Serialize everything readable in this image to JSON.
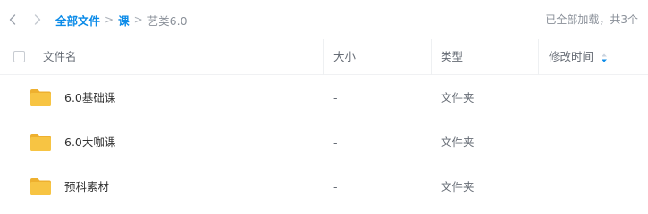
{
  "nav": {
    "back_icon": "chevron-left-icon",
    "forward_icon": "chevron-right-icon"
  },
  "breadcrumb": {
    "root": "全部文件",
    "separator": ">",
    "level1": "课",
    "current": "艺类6.0"
  },
  "status": {
    "load_text": "已全部加载，共3个"
  },
  "table": {
    "columns": {
      "name": "文件名",
      "size": "大小",
      "type": "类型",
      "mtime": "修改时间"
    },
    "sort_icon": "sort-desc-icon",
    "rows": [
      {
        "name": "6.0基础课",
        "size": "-",
        "type": "文件夹",
        "icon": "folder-icon"
      },
      {
        "name": "6.0大咖课",
        "size": "-",
        "type": "文件夹",
        "icon": "folder-icon"
      },
      {
        "name": "预科素材",
        "size": "-",
        "type": "文件夹",
        "icon": "folder-icon"
      }
    ]
  },
  "colors": {
    "link": "#0b8be8",
    "folder": "#f7c443",
    "folder_dark": "#eeb02f",
    "muted_text": "#8a9099"
  }
}
